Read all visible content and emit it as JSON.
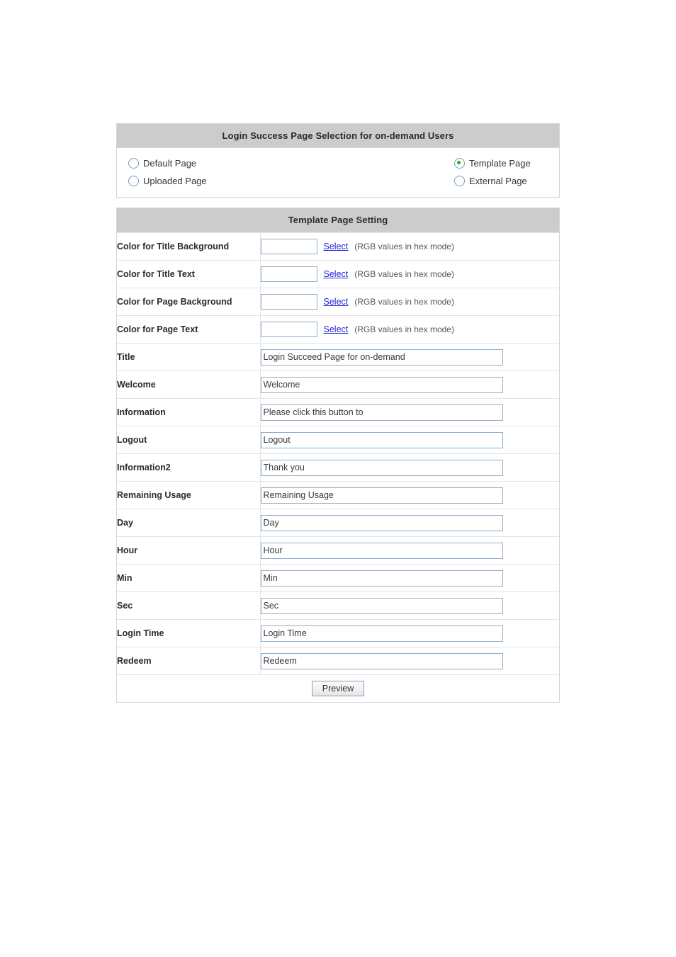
{
  "selection_panel": {
    "title": "Login Success Page Selection for on-demand Users",
    "options": [
      {
        "label": "Default Page",
        "checked": false
      },
      {
        "label": "Template Page",
        "checked": true
      },
      {
        "label": "Uploaded Page",
        "checked": false
      },
      {
        "label": "External Page",
        "checked": false
      }
    ]
  },
  "template_panel": {
    "title": "Template Page Setting",
    "hint_text": "(RGB values in hex mode)",
    "select_link_label": "Select",
    "color_rows": [
      {
        "label": "Color for Title Background",
        "value": ""
      },
      {
        "label": "Color for Title Text",
        "value": ""
      },
      {
        "label": "Color for Page Background",
        "value": ""
      },
      {
        "label": "Color for Page Text",
        "value": ""
      }
    ],
    "text_rows": [
      {
        "label": "Title",
        "value": "Login Succeed Page for on-demand"
      },
      {
        "label": "Welcome",
        "value": "Welcome"
      },
      {
        "label": "Information",
        "value": "Please click this button to"
      },
      {
        "label": "Logout",
        "value": "Logout"
      },
      {
        "label": "Information2",
        "value": "Thank you"
      },
      {
        "label": "Remaining Usage",
        "value": "Remaining Usage"
      },
      {
        "label": "Day",
        "value": "Day"
      },
      {
        "label": "Hour",
        "value": "Hour"
      },
      {
        "label": "Min",
        "value": "Min"
      },
      {
        "label": "Sec",
        "value": "Sec"
      },
      {
        "label": "Login Time",
        "value": "Login Time"
      },
      {
        "label": "Redeem",
        "value": "Redeem"
      }
    ],
    "preview_button_label": "Preview"
  },
  "colors": {
    "header_background": "#cccccc",
    "panel_border": "#d5d5d5",
    "row_border": "#e3e3e3",
    "input_border": "#8fadc9",
    "link": "#2222dd",
    "radio_selected_dot": "#2aa82a"
  }
}
